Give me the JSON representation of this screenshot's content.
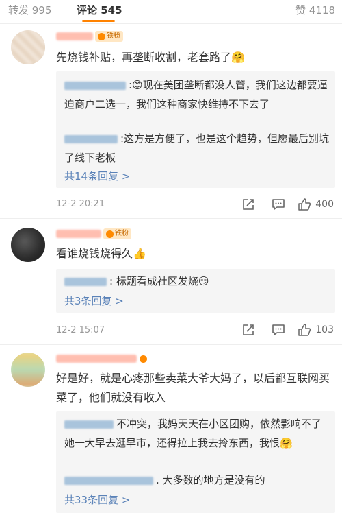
{
  "tabs": {
    "repost": "转发 995",
    "comments": "评论 545",
    "likes": "赞 4118"
  },
  "comments": [
    {
      "fan_badge": "铁粉",
      "text": "先烧钱补贴，再垄断收割，老套路了🤗",
      "replies": [
        {
          "text": ":😊现在美团垄断都没人管，我们这边都要逼迫商户二选一，我们这种商家快维持不下去了"
        },
        {
          "text": ":这方是方便了，也是这个趋势，但愿最后别坑了线下老板"
        }
      ],
      "more_replies": "共14条回复 >",
      "time": "12-2 20:21",
      "likes": "400"
    },
    {
      "fan_badge": "铁粉",
      "text": "看谁烧钱烧得久👍",
      "replies": [
        {
          "text": ": 标题看成社区发烧😏"
        }
      ],
      "more_replies": "共3条回复 >",
      "time": "12-2 15:07",
      "likes": "103"
    },
    {
      "fan_badge": "",
      "text": "好是好，就是心疼那些卖菜大爷大妈了，以后都互联网买菜了，他们就没有收入",
      "replies": [
        {
          "text": "不冲突，我妈天天在小区团购，依然影响不了她一大早去逛早市，还得拉上我去拎东西，我恨🤗"
        },
        {
          "text": ". 大多数的地方是没有的"
        }
      ],
      "more_replies": "共33条回复 >",
      "time": "",
      "likes": ""
    }
  ],
  "icons": {
    "share": "share-icon",
    "comment": "comment-icon",
    "like": "thumbs-up-icon",
    "fan": "fan-badge-icon"
  },
  "colors": {
    "accent": "#ff8200",
    "link": "#5a82b8",
    "reply_bg": "#f5f5f5"
  }
}
